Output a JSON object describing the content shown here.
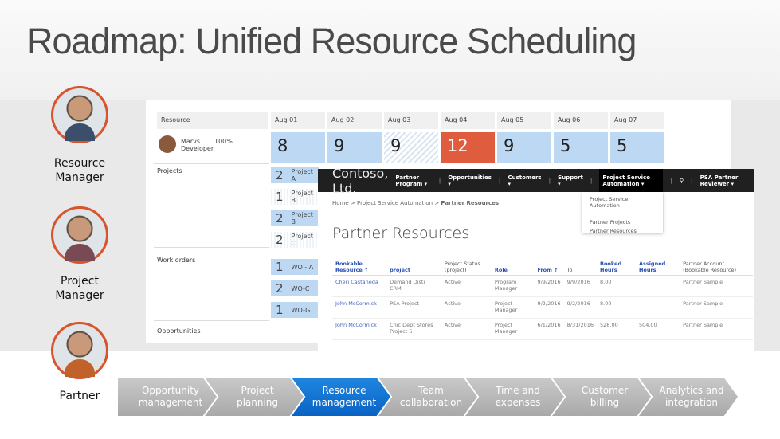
{
  "title": "Roadmap: Unified Resource Scheduling",
  "personas": [
    {
      "label": "Resource Manager"
    },
    {
      "label": "Project Manager"
    },
    {
      "label": "Partner"
    }
  ],
  "scheduler": {
    "resource_header": "Resource",
    "days": [
      "Aug 01",
      "Aug 02",
      "Aug 03",
      "Aug 04",
      "Aug 05",
      "Aug 06",
      "Aug 07"
    ],
    "resource": {
      "name": "Marvs",
      "role": "Developer",
      "utilization": "100%"
    },
    "hours": [
      "8",
      "9",
      "9",
      "12",
      "9",
      "5",
      "5"
    ],
    "sections": {
      "projects": "Projects",
      "work_orders": "Work orders",
      "opportunities": "Opportunities"
    },
    "projects": [
      {
        "n": "2",
        "label": "Project A"
      },
      {
        "n": "1",
        "label": "Project B"
      },
      {
        "n": "2",
        "label": "Project B"
      },
      {
        "n": "2",
        "label": "Project C"
      }
    ],
    "work_orders": [
      {
        "n": "1",
        "label": "WO - A"
      },
      {
        "n": "2",
        "label": "WO-C"
      },
      {
        "n": "1",
        "label": "WO-G"
      }
    ]
  },
  "portal": {
    "logo": "Contoso, Ltd.",
    "nav": [
      "Partner Program ▾",
      "Opportunities ▾",
      "Customers ▾",
      "Support ▾",
      "Project Service Automation ▾",
      "PSA Partner Reviewer ▾"
    ],
    "dropdown": [
      "Project Service Automation",
      "Partner Projects",
      "Partner Resources"
    ],
    "breadcrumb": [
      "Home",
      "Project Service Automation",
      "Partner Resources"
    ],
    "page_title": "Partner Resources",
    "columns": [
      "Bookable Resource ↑",
      "project",
      "Project Status (project)",
      "Role",
      "From ↑",
      "To",
      "Booked Hours",
      "Assigned Hours",
      "Partner Account (Bookable Resource)"
    ],
    "rows": [
      [
        "Cheri Castaneda",
        "Demand Disti CRM",
        "Active",
        "Program Manager",
        "9/9/2016",
        "9/9/2016",
        "8.00",
        "",
        "Partner Sample"
      ],
      [
        "John McCormick",
        "PSA Project",
        "Active",
        "Project Manager",
        "9/2/2016",
        "9/2/2016",
        "8.00",
        "",
        "Partner Sample"
      ],
      [
        "John McCormick",
        "Chic Dept Stores Project 5",
        "Active",
        "Project Manager",
        "6/1/2016",
        "8/31/2016",
        "528.00",
        "504.00",
        "Partner Sample"
      ]
    ]
  },
  "steps": [
    {
      "label": "Opportunity management",
      "active": false
    },
    {
      "label": "Project planning",
      "active": false
    },
    {
      "label": "Resource management",
      "active": true
    },
    {
      "label": "Team collaboration",
      "active": false
    },
    {
      "label": "Time and expenses",
      "active": false
    },
    {
      "label": "Customer billing",
      "active": false
    },
    {
      "label": "Analytics and integration",
      "active": false
    }
  ],
  "colors": {
    "accent_orange": "#d9532c",
    "over_booked": "#e05c3e",
    "booked": "#bcd8f3",
    "active_step": "#0a63c4"
  }
}
